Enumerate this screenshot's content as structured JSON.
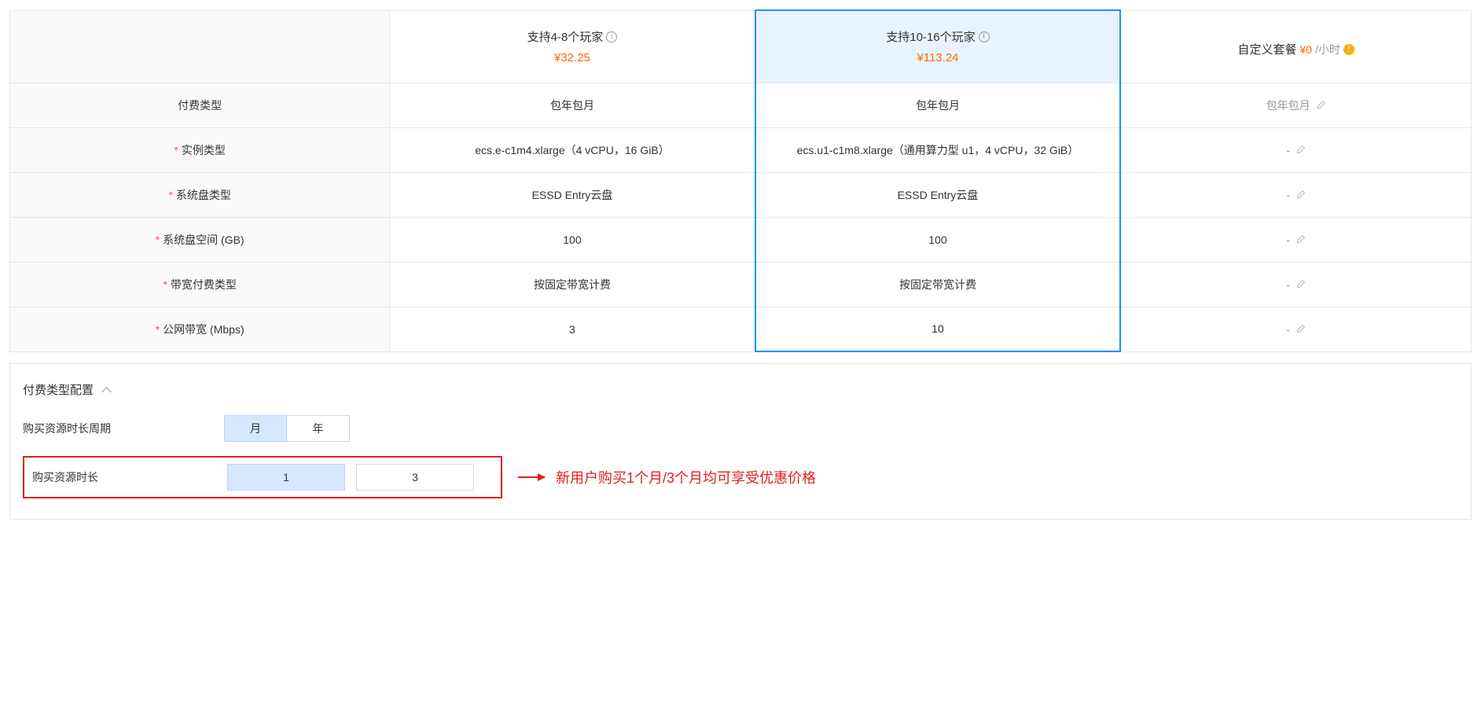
{
  "columns": {
    "plan1": {
      "title": "支持4-8个玩家",
      "price": "¥32.25"
    },
    "plan2": {
      "title": "支持10-16个玩家",
      "price": "¥113.24"
    },
    "custom": {
      "title": "自定义套餐",
      "price": "¥0",
      "price_unit": "/小时"
    }
  },
  "rows": {
    "billing_type": {
      "label": "付费类型",
      "plan1": "包年包月",
      "plan2": "包年包月",
      "custom": "包年包月"
    },
    "instance_type": {
      "label": "实例类型",
      "plan1": "ecs.e-c1m4.xlarge（4 vCPU，16 GiB）",
      "plan2": "ecs.u1-c1m8.xlarge（通用算力型 u1，4 vCPU，32 GiB）",
      "custom": "-"
    },
    "sys_disk_type": {
      "label": "系统盘类型",
      "plan1": "ESSD Entry云盘",
      "plan2": "ESSD Entry云盘",
      "custom": "-"
    },
    "sys_disk_size": {
      "label": "系统盘空间 (GB)",
      "plan1": "100",
      "plan2": "100",
      "custom": "-"
    },
    "bw_billing": {
      "label": "带宽付费类型",
      "plan1": "按固定带宽计费",
      "plan2": "按固定带宽计费",
      "custom": "-"
    },
    "public_bw": {
      "label": "公网带宽 (Mbps)",
      "plan1": "3",
      "plan2": "10",
      "custom": "-"
    }
  },
  "config": {
    "section_title": "付费类型配置",
    "period_cycle_label": "购买资源时长周期",
    "period_cycle_options": {
      "month": "月",
      "year": "年"
    },
    "duration_label": "购买资源时长",
    "duration_options": {
      "one": "1",
      "three": "3"
    },
    "promo_note": "新用户购买1个月/3个月均可享受优惠价格"
  }
}
